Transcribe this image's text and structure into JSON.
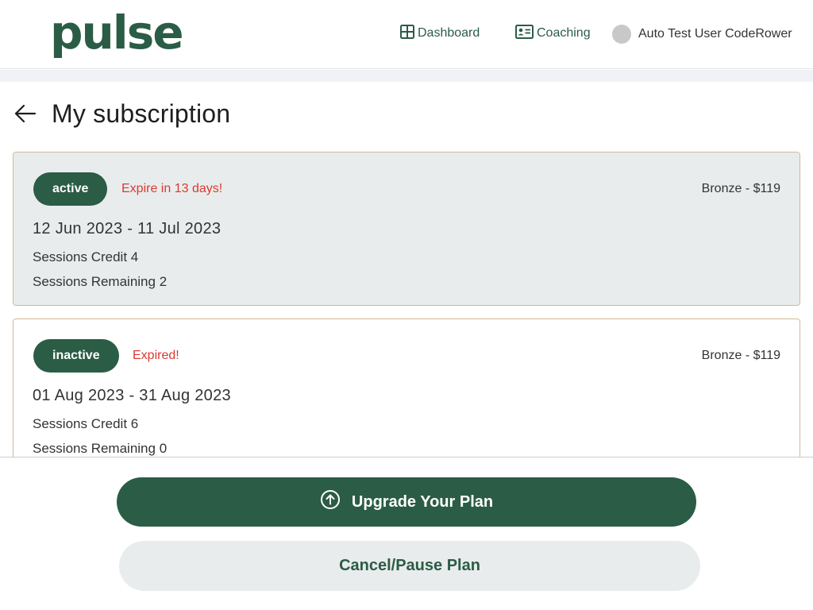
{
  "header": {
    "logo": "pulse",
    "nav": {
      "dashboard": "Dashboard",
      "coaching": "Coaching"
    },
    "user_name": "Auto Test User CodeRower"
  },
  "page": {
    "title": "My subscription"
  },
  "subscriptions": [
    {
      "status": "active",
      "expiry_note": "Expire in 13 days!",
      "plan": "Bronze - $119",
      "dates": "12 Jun 2023 - 11 Jul 2023",
      "sessions_credit": "Sessions Credit 4",
      "sessions_remaining": "Sessions Remaining 2"
    },
    {
      "status": "inactive",
      "expiry_note": "Expired!",
      "plan": "Bronze - $119",
      "dates": "01 Aug 2023 - 31 Aug 2023",
      "sessions_credit": "Sessions Credit 6",
      "sessions_remaining": "Sessions Remaining 0"
    }
  ],
  "actions": {
    "upgrade_label": "Upgrade Your Plan",
    "cancel_label": "Cancel/Pause Plan"
  },
  "icons": {
    "dashboard": "grid-icon",
    "coaching": "id-card-icon",
    "back": "arrow-left-icon",
    "upgrade": "arrow-up-circle-icon"
  },
  "colors": {
    "brand": "#2b5c46",
    "warning": "#d93a32",
    "card_border": "#d2bb98",
    "active_card_bg": "#e9ecec"
  }
}
